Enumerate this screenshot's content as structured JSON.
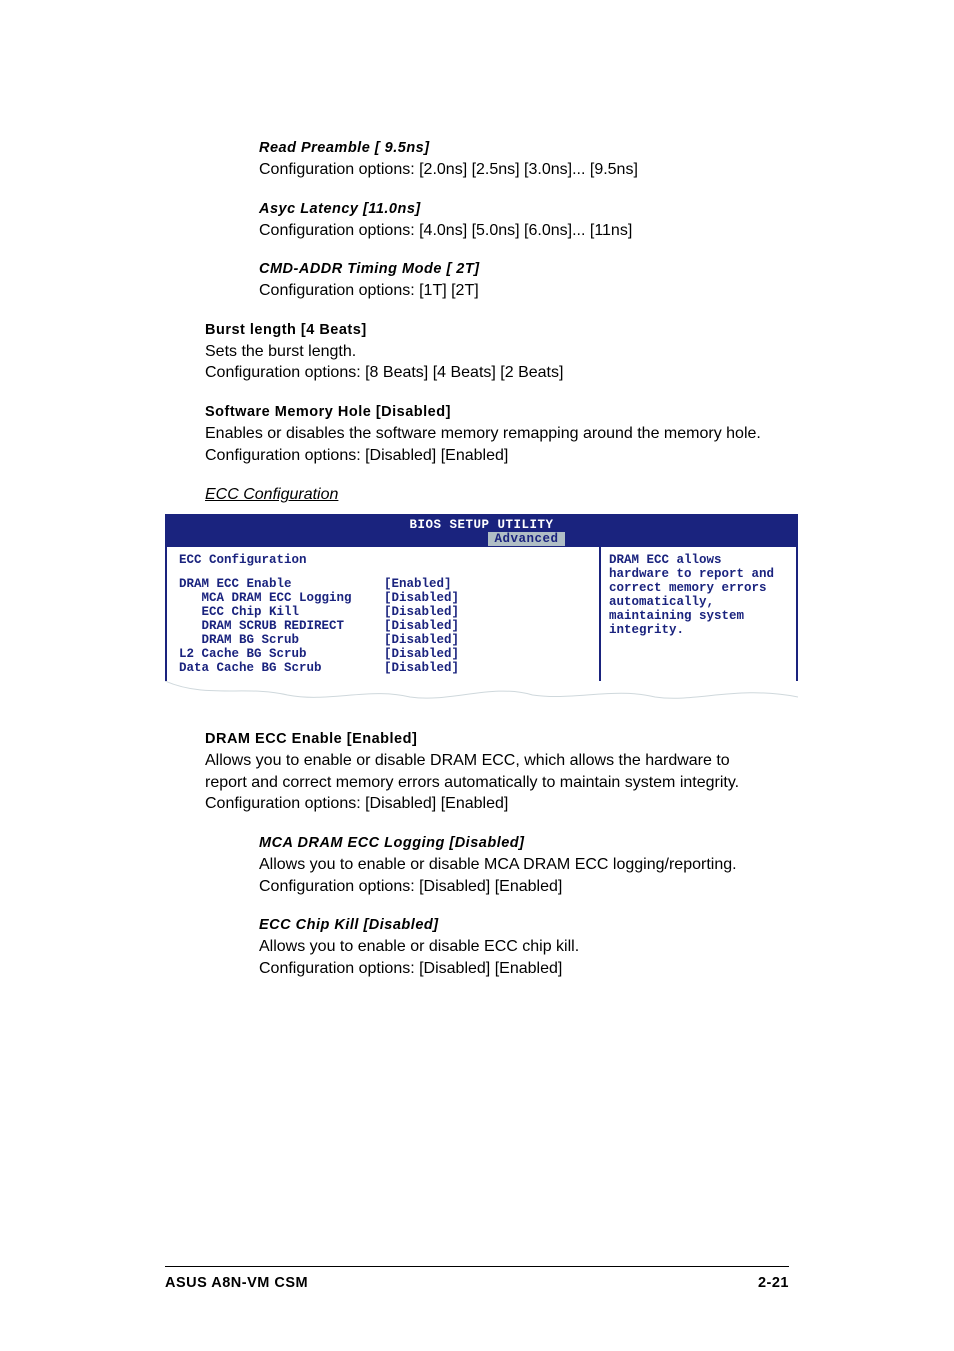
{
  "sections": {
    "read_preamble": {
      "title": "Read Preamble [ 9.5ns]",
      "desc": "Configuration options: [2.0ns] [2.5ns] [3.0ns]... [9.5ns]"
    },
    "async_latency": {
      "title": "Asyc Latency [11.0ns]",
      "desc": "Configuration options: [4.0ns] [5.0ns] [6.0ns]... [11ns]"
    },
    "cmd_addr": {
      "title": "CMD-ADDR Timing Mode [ 2T]",
      "desc": "Configuration options: [1T] [2T]"
    },
    "burst_length": {
      "title": "Burst length [4 Beats]",
      "desc1": "Sets the burst length.",
      "desc2": "Configuration options: [8 Beats] [4 Beats] [2 Beats]"
    },
    "software_memory_hole": {
      "title": "Software Memory Hole [Disabled]",
      "desc": "Enables or disables the software memory remapping around the memory hole. Configuration options: [Disabled] [Enabled]"
    },
    "ecc_config_heading": "ECC Configuration",
    "dram_ecc_enable": {
      "title": "DRAM ECC Enable [Enabled]",
      "desc": "Allows you to enable or disable DRAM ECC, which allows the hardware to report and correct memory errors automatically to maintain system integrity. Configuration options: [Disabled] [Enabled]"
    },
    "mca_dram_ecc": {
      "title": "MCA DRAM ECC Logging [Disabled]",
      "desc": "Allows you to enable or disable MCA DRAM ECC logging/reporting. Configuration options: [Disabled] [Enabled]"
    },
    "ecc_chip_kill": {
      "title": "ECC Chip Kill  [Disabled]",
      "desc1": "Allows you to enable or disable ECC chip kill.",
      "desc2": "Configuration options: [Disabled] [Enabled]"
    }
  },
  "bios": {
    "utility_title": "BIOS SETUP UTILITY",
    "tab": "Advanced",
    "panel_title": "ECC Configuration",
    "help": "DRAM ECC allows hardware to report and correct memory errors automatically, maintaining system integrity.",
    "rows": [
      {
        "label": "DRAM ECC Enable",
        "value": "[Enabled]",
        "indent": 0
      },
      {
        "label": "MCA DRAM ECC Logging",
        "value": "[Disabled]",
        "indent": 1
      },
      {
        "label": "ECC Chip Kill",
        "value": "[Disabled]",
        "indent": 1
      },
      {
        "label": "DRAM SCRUB REDIRECT",
        "value": "[Disabled]",
        "indent": 1
      },
      {
        "label": "DRAM BG Scrub",
        "value": "[Disabled]",
        "indent": 1
      },
      {
        "label": "L2 Cache BG Scrub",
        "value": "[Disabled]",
        "indent": 0
      },
      {
        "label": "Data Cache BG Scrub",
        "value": "[Disabled]",
        "indent": 0
      }
    ]
  },
  "footer": {
    "left": "ASUS A8N-VM CSM",
    "right": "2-21"
  }
}
